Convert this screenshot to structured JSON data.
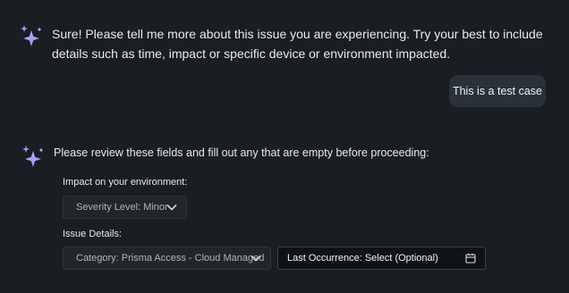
{
  "chat": {
    "assistant_message_1": "Sure! Please tell me more about this issue you are experiencing. Try your best to include details such as time, impact or specific device or environment impacted.",
    "user_message": "This is a test case",
    "assistant_message_2": "Please review these fields and fill out any that are empty before proceeding:"
  },
  "form": {
    "impact_label": "Impact on your environment:",
    "severity_dropdown": "Severity Level: Minor",
    "issue_details_label": "Issue Details:",
    "category_dropdown": "Category: Prisma Access - Cloud Managed",
    "last_occurrence_field": "Last Occurrence: Select (Optional)"
  },
  "icons": {
    "assistant_avatar": "sparkle-icon",
    "dropdown_arrow": "chevron-down-icon",
    "date_picker": "calendar-icon"
  },
  "colors": {
    "background": "#1a1d21",
    "sparkle_primary": "#8fa8ff",
    "sparkle_accent": "#c7a6ff",
    "user_bubble": "#2a3138"
  }
}
